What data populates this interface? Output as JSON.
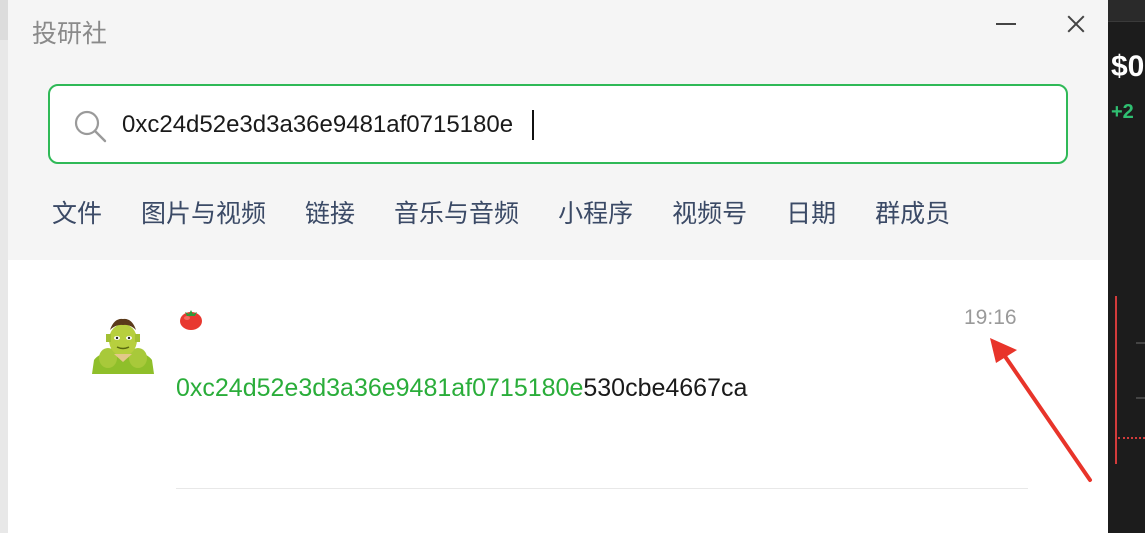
{
  "window": {
    "title": "投研社"
  },
  "search": {
    "value": "0xc24d52e3d3a36e9481af0715180e"
  },
  "filters": [
    "文件",
    "图片与视频",
    "链接",
    "音乐与音频",
    "小程序",
    "视频号",
    "日期",
    "群成员"
  ],
  "result": {
    "time": "19:16",
    "message_highlight": "0xc24d52e3d3a36e9481af0715180e",
    "message_rest": "530cbe4667ca"
  },
  "background_app": {
    "price_fragment": "$0",
    "change_fragment": "+2"
  },
  "colors": {
    "accent": "#2fb957",
    "highlight_text": "#2aad3a",
    "filter_text": "#3b4a66",
    "annotation_arrow": "#e8342a"
  }
}
